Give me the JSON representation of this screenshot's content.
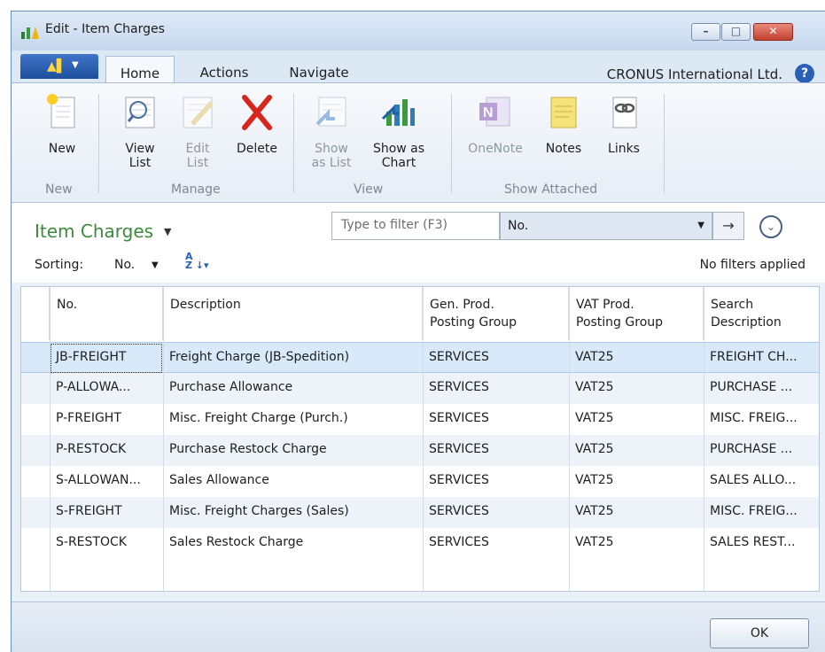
{
  "window": {
    "title": "Edit - Item Charges",
    "buttons": {
      "minimize": "–",
      "maximize": "□",
      "close": "✕"
    }
  },
  "ribbon": {
    "app_menu_icon": "dynamics-nav-icon",
    "tabs": [
      "Home",
      "Actions",
      "Navigate"
    ],
    "active_tab": "Home",
    "company": "CRONUS International Ltd.",
    "help": "?",
    "groups": [
      {
        "label": "New",
        "buttons": [
          {
            "label": "New",
            "icon": "new-document-icon",
            "enabled": true
          }
        ]
      },
      {
        "label": "Manage",
        "buttons": [
          {
            "label": "View\nList",
            "icon": "view-list-icon",
            "enabled": true
          },
          {
            "label": "Edit\nList",
            "icon": "edit-list-icon",
            "enabled": false
          },
          {
            "label": "Delete",
            "icon": "delete-icon",
            "enabled": true
          }
        ]
      },
      {
        "label": "View",
        "buttons": [
          {
            "label": "Show\nas List",
            "icon": "show-as-list-icon",
            "enabled": false
          },
          {
            "label": "Show as\nChart",
            "icon": "chart-icon",
            "enabled": true
          }
        ]
      },
      {
        "label": "Show Attached",
        "buttons": [
          {
            "label": "OneNote",
            "icon": "onenote-icon",
            "enabled": false
          },
          {
            "label": "Notes",
            "icon": "notes-icon",
            "enabled": true
          },
          {
            "label": "Links",
            "icon": "links-icon",
            "enabled": true
          }
        ]
      }
    ]
  },
  "list": {
    "title": "Item Charges",
    "filter_placeholder": "Type to filter (F3)",
    "filter_field": "No.",
    "go_arrow": "→",
    "sorting_label": "Sorting:",
    "sorting_value": "No.",
    "filter_status": "No filters applied"
  },
  "table": {
    "columns": [
      "No.",
      "Description",
      "Gen. Prod.\nPosting Group",
      "VAT Prod.\nPosting Group",
      "Search\nDescription"
    ],
    "rows": [
      [
        "JB-FREIGHT",
        "Freight Charge (JB-Spedition)",
        "SERVICES",
        "VAT25",
        "FREIGHT CH..."
      ],
      [
        "P-ALLOWA...",
        "Purchase Allowance",
        "SERVICES",
        "VAT25",
        "PURCHASE ..."
      ],
      [
        "P-FREIGHT",
        "Misc. Freight Charge (Purch.)",
        "SERVICES",
        "VAT25",
        "MISC. FREIG..."
      ],
      [
        "P-RESTOCK",
        "Purchase Restock Charge",
        "SERVICES",
        "VAT25",
        "PURCHASE ..."
      ],
      [
        "S-ALLOWAN...",
        "Sales Allowance",
        "SERVICES",
        "VAT25",
        "SALES ALLO..."
      ],
      [
        "S-FREIGHT",
        "Misc. Freight Charges (Sales)",
        "SERVICES",
        "VAT25",
        "MISC. FREIG..."
      ],
      [
        "S-RESTOCK",
        "Sales Restock Charge",
        "SERVICES",
        "VAT25",
        "SALES REST..."
      ]
    ],
    "selected_row": 0
  },
  "footer": {
    "ok_label": "OK"
  },
  "colors": {
    "title_green": "#3c8b3c",
    "selection": "#d8eaf9",
    "accent_blue": "#2a5fb6"
  }
}
